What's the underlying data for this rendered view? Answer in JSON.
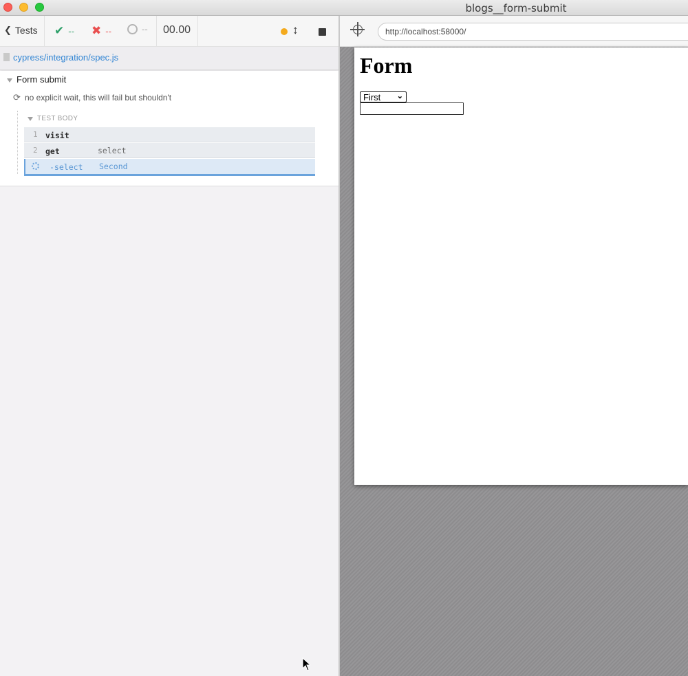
{
  "window": {
    "title": "blogs__form-submit"
  },
  "reporter": {
    "header": {
      "tests_label": "Tests",
      "passed": "--",
      "failed": "--",
      "pending": "--",
      "duration": "00.00",
      "running_indicator_color": "#f4aa1d"
    },
    "spec_path": "cypress/integration/spec.js",
    "suite": {
      "title": "Form submit",
      "test": {
        "title": "no explicit wait, this will fail but shouldn't",
        "section_label": "TEST BODY",
        "commands": [
          {
            "number": "1",
            "name": "visit",
            "message": ""
          },
          {
            "number": "2",
            "name": "get",
            "message": "select"
          },
          {
            "number": "",
            "name": "-select",
            "message": "Second",
            "state": "pending"
          }
        ]
      }
    }
  },
  "aut": {
    "url": "http://localhost:58000/",
    "page": {
      "heading": "Form",
      "select_value": "First",
      "input_value": ""
    }
  },
  "colors": {
    "pass": "#2fa06a",
    "fail": "#e94f4f",
    "link": "#3386d4",
    "active_command": "#6aa3dc"
  }
}
